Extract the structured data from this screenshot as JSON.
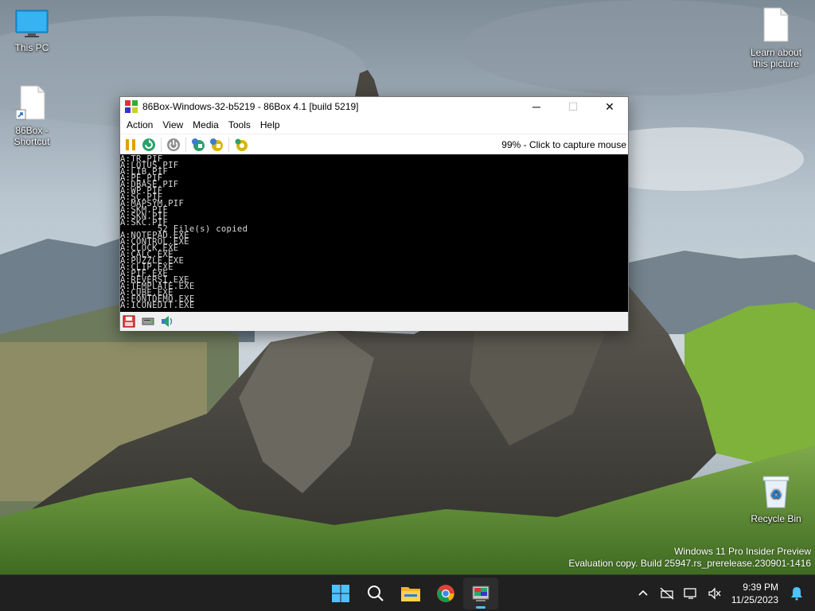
{
  "desktop": {
    "icons": [
      {
        "label": "This PC",
        "icon": "monitor-icon"
      },
      {
        "label": "86Box - Shortcut",
        "icon": "shortcut-file-icon"
      },
      {
        "label": "Learn about this picture",
        "icon": "file-icon"
      },
      {
        "label": "Recycle Bin",
        "icon": "recycle-bin-icon"
      }
    ]
  },
  "window": {
    "title": "86Box-Windows-32-b5219 - 86Box 4.1 [build 5219]",
    "controls": {
      "minimize": "─",
      "maximize": "☐",
      "close": "✕"
    },
    "menu": [
      "Action",
      "View",
      "Media",
      "Tools",
      "Help"
    ],
    "toolbar": {
      "buttons": [
        "pause-icon",
        "reset-icon",
        "power-icon",
        "ctrl-alt-del-icon",
        "ctrl-alt-esc-icon",
        "settings-icon"
      ],
      "capture_text": "99% - Click to capture mouse"
    },
    "console_lines": [
      "A:TR.PIF",
      "A:LOTUS.PIF",
      "A:LIB.PIF",
      "A:PE.PIF",
      "A:DBASE.PIF",
      "A:WP.PIF",
      "A:SC.PIF",
      "A:MAPSYM.PIF",
      "A:SKM.PIF",
      "A:SKN.PIF",
      "A:SKC.PIF",
      "       52 File(s) copied",
      "A:NOTEPAD.EXE",
      "A:CONTROL.EXE",
      "A:CLOCK.EXE",
      "A:CALC.EXE",
      "A:PUZZLE.EXE",
      "A:CLIP.EXE",
      "A:PIF.EXE",
      "A:REVERSI.EXE",
      "A:TEMPLATE.EXE",
      "A:CUBE.EXE",
      "A:FONTDEMO.EXE",
      "A:ICONEDIT.EXE"
    ],
    "statusbar": [
      "floppy-drive-icon",
      "hard-disk-icon",
      "sound-icon"
    ]
  },
  "watermark": {
    "line1": "Windows 11 Pro Insider Preview",
    "line2": "Evaluation copy. Build 25947.rs_prerelease.230901-1416"
  },
  "taskbar": {
    "apps": [
      "start-icon",
      "search-icon",
      "file-explorer-icon",
      "chrome-icon",
      "86box-icon"
    ],
    "tray": [
      "chevron-up-icon",
      "network-icon",
      "display-icon",
      "volume-muted-icon"
    ],
    "time": "9:39 PM",
    "date": "11/25/2023"
  },
  "colors": {
    "taskbar": "#202020",
    "accent": "#4cc2ff",
    "console_bg": "#000000",
    "console_fg": "#d8d8d8"
  }
}
